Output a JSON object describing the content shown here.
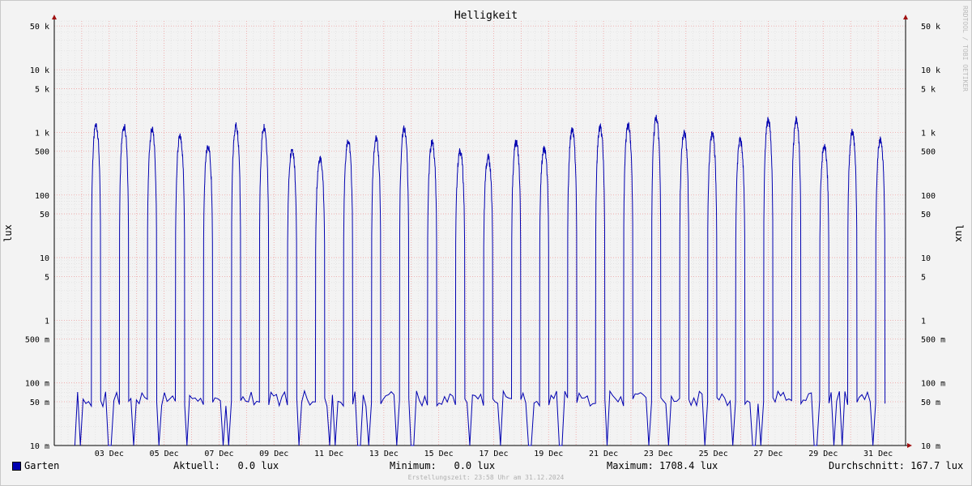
{
  "chart_data": {
    "type": "line",
    "title": "Helligkeit",
    "ylabel": "lux",
    "ylabel_right": "lux",
    "yscale": "log",
    "ylim": [
      10,
      60000
    ],
    "yticks": [
      {
        "value": 50000,
        "label": "50 k"
      },
      {
        "value": 10000,
        "label": "10 k"
      },
      {
        "value": 5000,
        "label": "5 k"
      },
      {
        "value": 1000,
        "label": "1 k"
      },
      {
        "value": 500,
        "label": "500"
      },
      {
        "value": 100,
        "label": "100"
      },
      {
        "value": 50,
        "label": "50"
      },
      {
        "value": 10,
        "label": "10"
      },
      {
        "value": 5,
        "label": "5"
      },
      {
        "value": 1,
        "label": "1"
      },
      {
        "value": 0.5,
        "label": "500 m"
      },
      {
        "value": 0.1,
        "label": "100 m"
      },
      {
        "value": 0.05,
        "label": "50 m"
      },
      {
        "value": 0.01,
        "label": "10 m"
      }
    ],
    "xticks": [
      "03 Dec",
      "05 Dec",
      "07 Dec",
      "09 Dec",
      "11 Dec",
      "13 Dec",
      "15 Dec",
      "17 Dec",
      "19 Dec",
      "21 Dec",
      "23 Dec",
      "25 Dec",
      "27 Dec",
      "29 Dec",
      "31 Dec"
    ],
    "color": "#0000b0",
    "grid": true,
    "series": [
      {
        "name": "Garten",
        "daily_peaks": [
          1300,
          1250,
          1100,
          850,
          600,
          1300,
          1250,
          550,
          400,
          750,
          800,
          1150,
          700,
          500,
          400,
          700,
          550,
          1100,
          1200,
          1300,
          1700,
          1000,
          950,
          750,
          1600,
          1600,
          600,
          1000,
          750
        ],
        "night_level": 0.05
      }
    ]
  },
  "legend": {
    "series_name": "Garten",
    "current": "Aktuell:   0.0 lux",
    "minimum": "Minimum:   0.0 lux",
    "maximum": "Maximum: 1708.4 lux",
    "average": "Durchschnitt: 167.7 lux"
  },
  "watermark": "RRDTOOL / TOBI OETIKER",
  "footer": "Erstellungszeit: 23:58 Uhr am 31.12.2024"
}
